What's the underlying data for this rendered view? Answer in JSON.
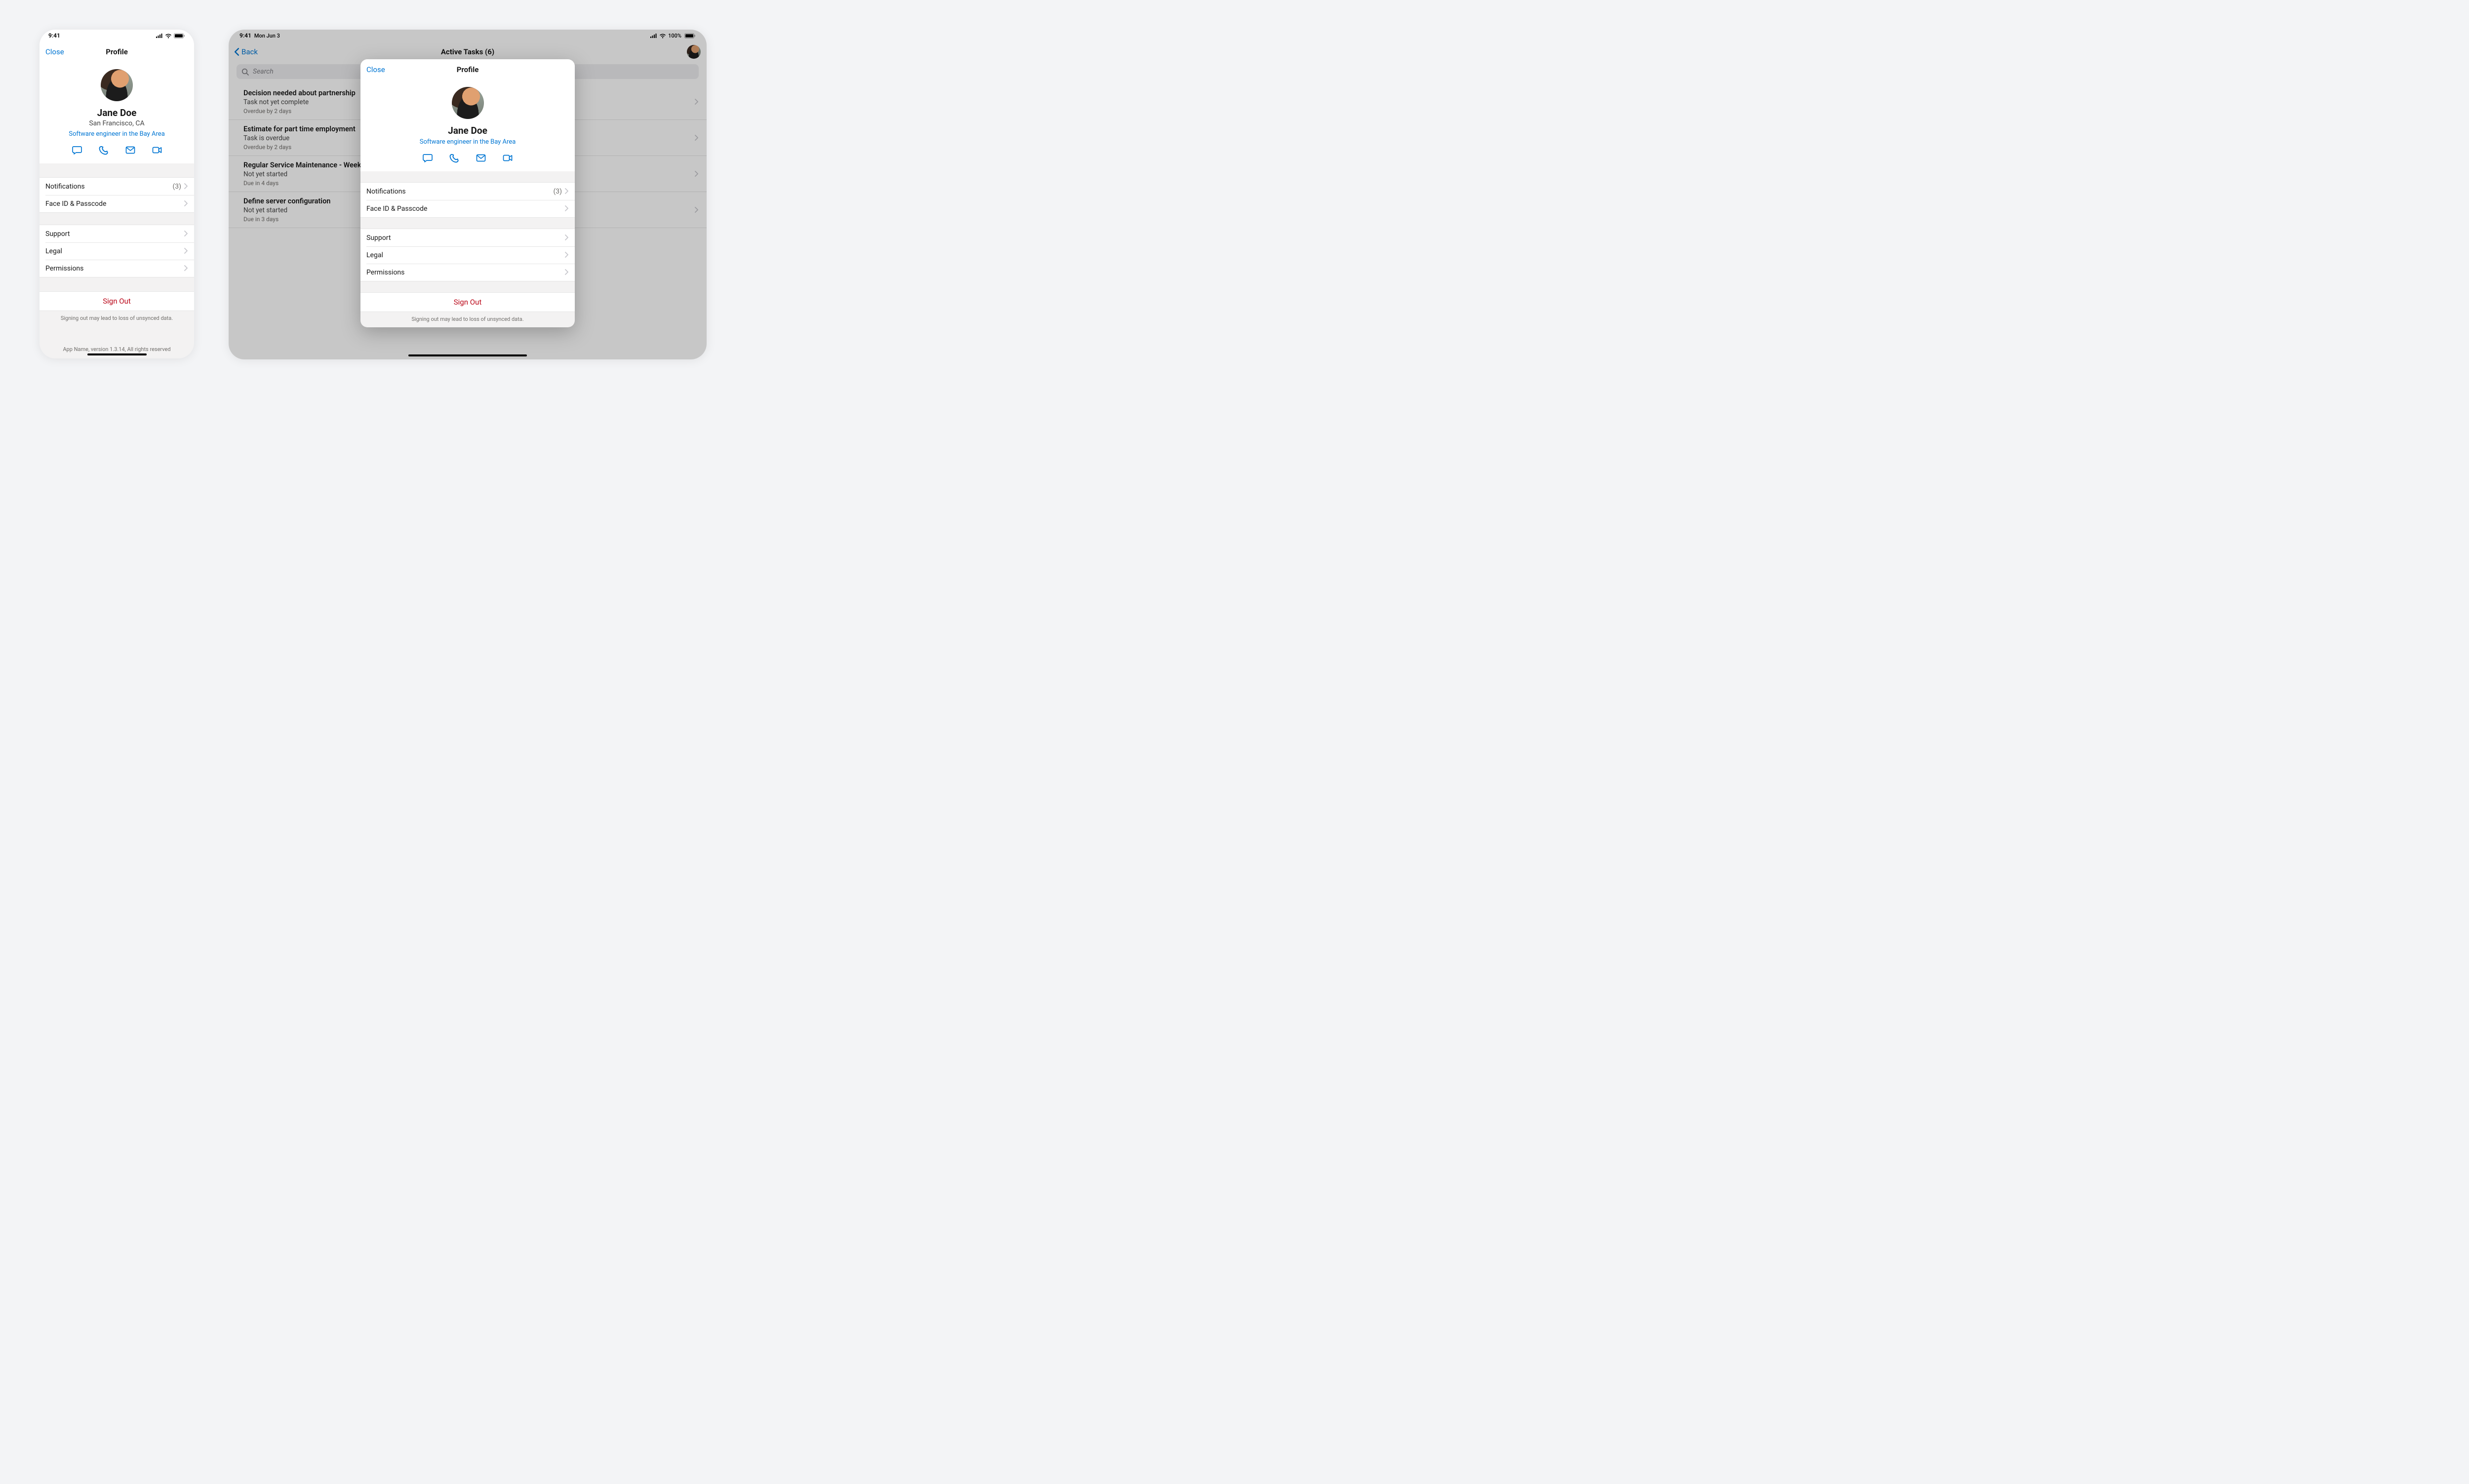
{
  "phone": {
    "status": {
      "time": "9:41"
    },
    "nav": {
      "close": "Close",
      "title": "Profile"
    },
    "profile": {
      "name": "Jane Doe",
      "location": "San Francisco, CA",
      "bio": "Software engineer in the Bay Area"
    },
    "settings1": {
      "notifications": {
        "label": "Notifications",
        "badge": "(3)"
      },
      "faceid": {
        "label": "Face ID & Passcode"
      }
    },
    "settings2": {
      "support": {
        "label": "Support"
      },
      "legal": {
        "label": "Legal"
      },
      "permissions": {
        "label": "Permissions"
      }
    },
    "signout": {
      "label": "Sign Out",
      "note": "Signing out may lead to loss of unsynced data."
    },
    "footer": "App Name, version 1.3.14, All rights reserved"
  },
  "tablet": {
    "status": {
      "time": "9:41",
      "date": "Mon Jun 3",
      "battery": "100%"
    },
    "nav": {
      "back": "Back",
      "title": "Active Tasks (6)"
    },
    "search": {
      "placeholder": "Search"
    },
    "tasks": [
      {
        "title": "Decision needed about partnership",
        "sub": "Task not yet complete",
        "due": "Overdue by 2 days"
      },
      {
        "title": "Estimate for part time employment",
        "sub": "Task is overdue",
        "due": "Overdue by 2 days"
      },
      {
        "title": "Regular Service Maintenance - Weekly",
        "sub": "Not yet started",
        "due": "Due in 4 days"
      },
      {
        "title": "Define server configuration",
        "sub": "Not yet started",
        "due": "Due in 3 days"
      }
    ],
    "popover": {
      "nav": {
        "close": "Close",
        "title": "Profile"
      },
      "profile": {
        "name": "Jane Doe",
        "bio": "Software engineer in the Bay Area"
      },
      "settings1": {
        "notifications": {
          "label": "Notifications",
          "badge": "(3)"
        },
        "faceid": {
          "label": "Face ID & Passcode"
        }
      },
      "settings2": {
        "support": {
          "label": "Support"
        },
        "legal": {
          "label": "Legal"
        },
        "permissions": {
          "label": "Permissions"
        }
      },
      "signout": {
        "label": "Sign Out",
        "note": "Signing out may lead to loss of unsynced data."
      }
    }
  }
}
